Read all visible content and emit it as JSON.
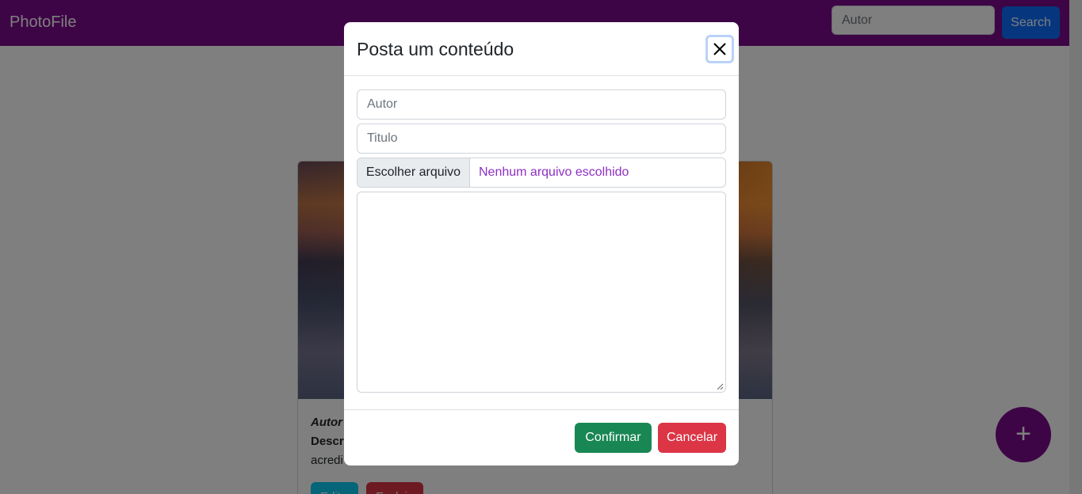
{
  "navbar": {
    "brand": "PhotoFile",
    "search_placeholder": "Autor",
    "search_button": "Search"
  },
  "card": {
    "author_label": "Autor",
    "description_label": "Descr",
    "description_text": "acredi",
    "edit_button": "Edit",
    "delete_button": "Excluir"
  },
  "fab": {
    "label": "+"
  },
  "modal": {
    "title": "Posta um conteúdo",
    "author_placeholder": "Autor",
    "title_placeholder": "Titulo",
    "file_button": "Escolher arquivo",
    "file_status": "Nenhum arquivo escolhido",
    "textarea_value": "",
    "confirm_button": "Confirmar",
    "cancel_button": "Cancelar"
  },
  "colors": {
    "brand_purple": "#7c0a8c",
    "primary_blue": "#0d6efd",
    "success_green": "#198754",
    "danger_red": "#dc3545",
    "info_cyan": "#0dcaf0"
  }
}
